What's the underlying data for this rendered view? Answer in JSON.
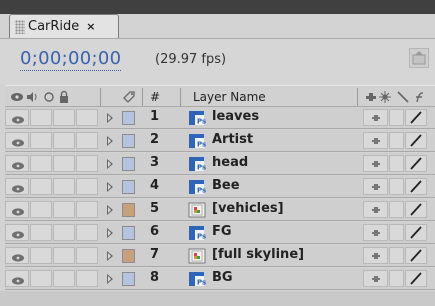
{
  "panel": {
    "tab_title": "CarRide",
    "tab_close": "×"
  },
  "header": {
    "timecode": "0;00;00;00",
    "fps": "(29.97 fps)"
  },
  "columns": {
    "number": "#",
    "layer_name": "Layer Name"
  },
  "colors": {
    "label_blue": "#b4c4de",
    "label_tan": "#c8a07a",
    "timecode_blue": "#3a62ad"
  },
  "layers": [
    {
      "number": "1",
      "name": "leaves",
      "label_color": "#b4c4de",
      "icon": "photoshop-layer-icon"
    },
    {
      "number": "2",
      "name": "Artist",
      "label_color": "#b4c4de",
      "icon": "photoshop-layer-icon"
    },
    {
      "number": "3",
      "name": "head",
      "label_color": "#b4c4de",
      "icon": "photoshop-layer-icon"
    },
    {
      "number": "4",
      "name": "Bee",
      "label_color": "#b4c4de",
      "icon": "photoshop-layer-icon"
    },
    {
      "number": "5",
      "name": "[vehicles]",
      "label_color": "#c8a07a",
      "icon": "precomp-icon"
    },
    {
      "number": "6",
      "name": "FG",
      "label_color": "#b4c4de",
      "icon": "photoshop-layer-icon"
    },
    {
      "number": "7",
      "name": "[full skyline]",
      "label_color": "#c8a07a",
      "icon": "precomp-icon"
    },
    {
      "number": "8",
      "name": "BG",
      "label_color": "#b4c4de",
      "icon": "photoshop-layer-icon"
    }
  ]
}
